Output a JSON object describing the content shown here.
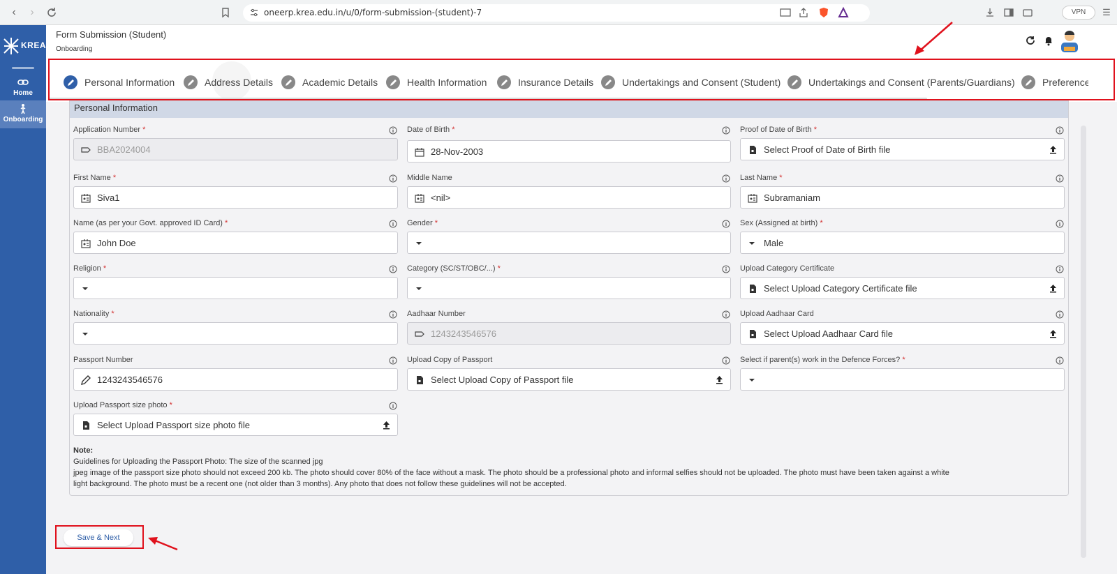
{
  "browser": {
    "url": "oneerp.krea.edu.in/u/0/form-submission-(student)-7",
    "vpn_label": "VPN"
  },
  "sidebar": {
    "logo_text": "KREA",
    "items": [
      {
        "label": "Home",
        "icon": "link-icon"
      },
      {
        "label": "Onboarding",
        "icon": "person-walking-icon"
      }
    ]
  },
  "header": {
    "title": "Form Submission (Student)",
    "subtitle": "Onboarding"
  },
  "tabs": [
    {
      "label": "Personal Information",
      "active": true
    },
    {
      "label": "Address Details"
    },
    {
      "label": "Academic Details"
    },
    {
      "label": "Health Information"
    },
    {
      "label": "Insurance Details"
    },
    {
      "label": "Undertakings and Consent (Student)"
    },
    {
      "label": "Undertakings and Consent (Parents/Guardians)"
    },
    {
      "label": "Preference"
    }
  ],
  "section": {
    "title": "Personal Information"
  },
  "fields": {
    "application_number": {
      "label": "Application Number",
      "value": "BBA2024004"
    },
    "date_of_birth": {
      "label": "Date of Birth",
      "value": "28-Nov-2003"
    },
    "proof_dob": {
      "label": "Proof of Date of Birth",
      "value": "Select Proof of Date of Birth file"
    },
    "first_name": {
      "label": "First Name",
      "value": "Siva1"
    },
    "middle_name": {
      "label": "Middle Name",
      "value": "<nil>"
    },
    "last_name": {
      "label": "Last Name",
      "value": "Subramaniam"
    },
    "id_name": {
      "label": "Name (as per your Govt. approved ID Card)",
      "value": "John Doe"
    },
    "gender": {
      "label": "Gender",
      "value": ""
    },
    "sex": {
      "label": "Sex (Assigned at birth)",
      "value": "Male"
    },
    "religion": {
      "label": "Religion",
      "value": ""
    },
    "category": {
      "label": "Category (SC/ST/OBC/...)",
      "value": ""
    },
    "category_cert": {
      "label": "Upload Category Certificate",
      "value": "Select Upload Category Certificate file"
    },
    "nationality": {
      "label": "Nationality",
      "value": ""
    },
    "aadhaar_number": {
      "label": "Aadhaar Number",
      "value": "1243243546576"
    },
    "aadhaar_card": {
      "label": "Upload Aadhaar Card",
      "value": "Select Upload Aadhaar Card file"
    },
    "passport_number": {
      "label": "Passport Number",
      "value": "1243243546576"
    },
    "passport_copy": {
      "label": "Upload Copy of Passport",
      "value": "Select Upload Copy of Passport file"
    },
    "defence": {
      "label": "Select if parent(s) work in the Defence Forces?",
      "value": ""
    },
    "passport_photo": {
      "label": "Upload Passport size photo",
      "value": "Select Upload Passport size photo file"
    }
  },
  "required_mark": "*",
  "note": {
    "title": "Note:",
    "lines": [
      "Guidelines for Uploading the Passport Photo: The size of the scanned jpg",
      " jpeg image of the passport size photo should not exceed 200 kb. The photo should cover 80% of the face without a mask. The photo should be a professional photo and informal selfies should not be uploaded. The photo must have been taken against a white",
      " light background. The photo must be a recent one (not older than 3 months). Any photo that does not follow these guidelines will not be accepted."
    ]
  },
  "actions": {
    "save_next": "Save & Next"
  },
  "colors": {
    "brand": "#2f5fa8",
    "annotation": "#e0111c",
    "required": "#d32f2f"
  }
}
